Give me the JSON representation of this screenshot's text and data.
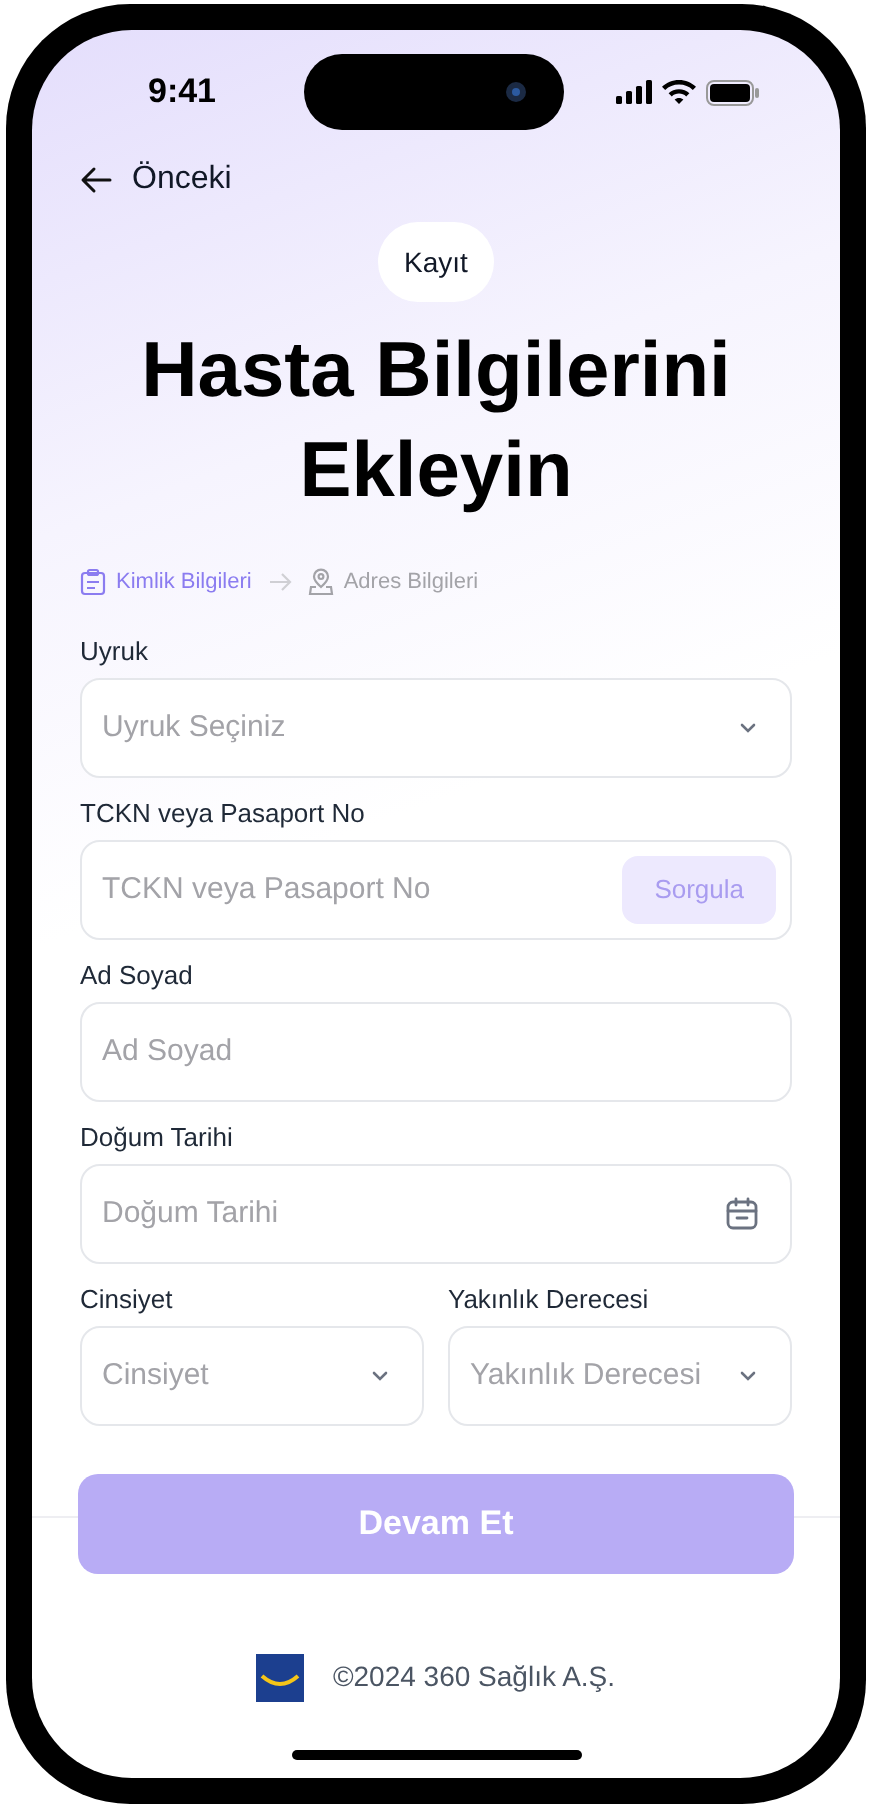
{
  "status_bar": {
    "time": "9:41"
  },
  "nav": {
    "back_label": "Önceki"
  },
  "badge": "Kayıt",
  "title": "Hasta Bilgilerini Ekleyin",
  "steps": [
    {
      "label": "Kimlik Bilgileri",
      "kind": "id",
      "selected": true
    },
    {
      "label": "Adres Bilgileri",
      "kind": "address",
      "selected": false
    }
  ],
  "fields": [
    {
      "kind": "select",
      "label": "Uyruk",
      "placeholder": "Uyruk Seçiniz"
    },
    {
      "kind": "query",
      "label": "TCKN veya Pasaport No",
      "placeholder": "TCKN veya Pasaport No",
      "button": "Sorgula",
      "button_disabled": true
    },
    {
      "kind": "text",
      "label": "Ad Soyad",
      "placeholder": "Ad Soyad"
    },
    {
      "kind": "date",
      "label": "Doğum Tarihi",
      "placeholder": "Doğum Tarihi"
    }
  ],
  "paired_fields": [
    {
      "kind": "select",
      "label": "Cinsiyet",
      "placeholder": "Cinsiyet"
    },
    {
      "kind": "select",
      "label": "Yakınlık Derecesi",
      "placeholder": "Yakınlık Derecesi"
    }
  ],
  "submit": {
    "label": "Devam Et",
    "disabled": true
  },
  "footer": {
    "copyright": "©2024 360 Sağlık A.Ş."
  }
}
